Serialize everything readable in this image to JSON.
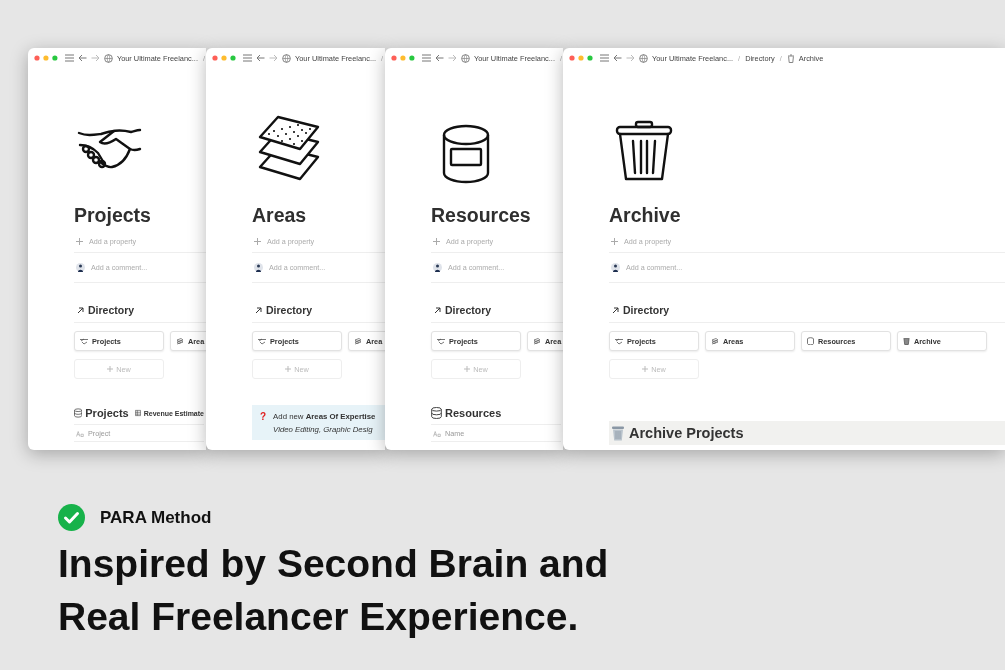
{
  "windows": [
    {
      "kind": "projects",
      "breadcrumb": [
        {
          "kind": "workspace",
          "text": "Your Ultimate Freelanc..."
        },
        {
          "kind": "separator",
          "text": "/"
        }
      ],
      "title": "Projects",
      "property_hint": "Add a property",
      "comment_placeholder": "Add a comment...",
      "section": "Directory",
      "cards": [
        {
          "kind": "projects",
          "label": "Projects"
        },
        {
          "kind": "areas",
          "label": "Area"
        }
      ],
      "new_button": "New",
      "block": {
        "kind": "database",
        "title": "Projects",
        "view": "Revenue Estimate",
        "column": "Project"
      }
    },
    {
      "kind": "areas",
      "breadcrumb": [
        {
          "kind": "workspace",
          "text": "Your Ultimate Freelanc..."
        },
        {
          "kind": "separator",
          "text": "/"
        }
      ],
      "title": "Areas",
      "property_hint": "Add a property",
      "comment_placeholder": "Add a comment...",
      "section": "Directory",
      "cards": [
        {
          "kind": "projects",
          "label": "Projects"
        },
        {
          "kind": "areas",
          "label": "Area"
        }
      ],
      "new_button": "New",
      "block": {
        "kind": "callout",
        "mark": "?",
        "text": "Add new **Areas Of Expertise**",
        "note": "Video Editing, Graphic Desig"
      }
    },
    {
      "kind": "resources",
      "breadcrumb": [
        {
          "kind": "workspace",
          "text": "Your Ultimate Freelanc..."
        },
        {
          "kind": "separator",
          "text": "/"
        }
      ],
      "title": "Resources",
      "property_hint": "Add a property",
      "comment_placeholder": "Add a comment...",
      "section": "Directory",
      "cards": [
        {
          "kind": "projects",
          "label": "Projects"
        },
        {
          "kind": "areas",
          "label": "Area"
        }
      ],
      "new_button": "New",
      "block": {
        "kind": "database",
        "title": "Resources",
        "column": "Name"
      }
    },
    {
      "kind": "archive",
      "breadcrumb": [
        {
          "kind": "workspace",
          "text": "Your Ultimate Freelanc..."
        },
        {
          "kind": "separator",
          "text": "/"
        },
        {
          "kind": "page",
          "text": "Directory"
        },
        {
          "kind": "separator",
          "text": "/"
        },
        {
          "kind": "current",
          "text": "Archive"
        }
      ],
      "title": "Archive",
      "property_hint": "Add a property",
      "comment_placeholder": "Add a comment...",
      "section": "Directory",
      "cards": [
        {
          "kind": "projects",
          "label": "Projects"
        },
        {
          "kind": "areas",
          "label": "Areas"
        },
        {
          "kind": "resources",
          "label": "Resources"
        },
        {
          "kind": "archive",
          "label": "Archive"
        }
      ],
      "new_button": "New",
      "block": {
        "kind": "heading",
        "title": "Archive Projects"
      }
    }
  ],
  "feature": {
    "label": "PARA Method",
    "checked": true
  },
  "headline": [
    "Inspired by Second Brain and",
    "Real Freelancer Experience."
  ]
}
